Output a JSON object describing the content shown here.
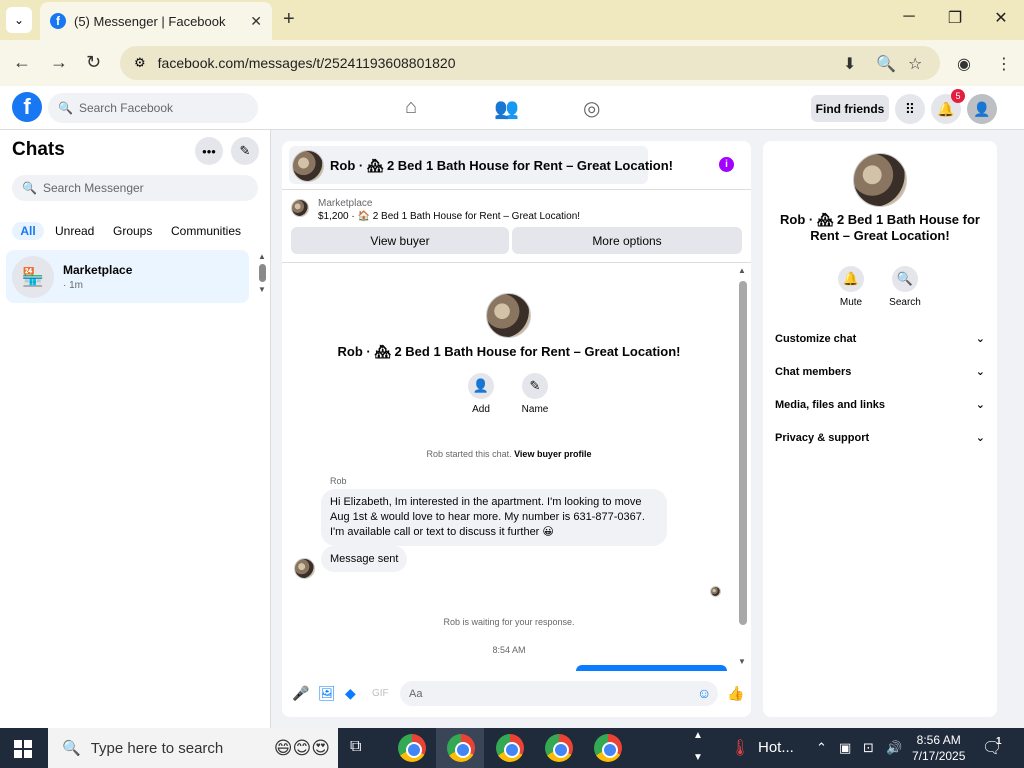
{
  "browser": {
    "tab_title": "(5) Messenger | Facebook",
    "url": "facebook.com/messages/t/25241193608801820"
  },
  "fb_header": {
    "search_placeholder": "Search Facebook",
    "find_friends": "Find friends",
    "notif_count": "5"
  },
  "chats": {
    "title": "Chats",
    "search_placeholder": "Search Messenger",
    "filters": [
      "All",
      "Unread",
      "Groups",
      "Communities"
    ],
    "items": [
      {
        "name": "Marketplace",
        "time": "· 1m"
      }
    ]
  },
  "conversation": {
    "header_title": "Rob · 🏘 2 Bed 1 Bath House for Rent – Great Location!",
    "marketplace_label": "Marketplace",
    "listing_line": "$1,200 · 🏠 2 Bed 1 Bath House for Rent – Great Location!",
    "view_buyer": "View buyer",
    "more_options": "More options",
    "center_title": "Rob · 🏘 2 Bed 1 Bath House for Rent – Great Location!",
    "add_label": "Add",
    "name_label": "Name",
    "started_prefix": "Rob started this chat.",
    "started_link": "View buyer profile",
    "sender": "Rob",
    "message1": "Hi Elizabeth, Im interested in the apartment. I'm looking to move Aug 1st & would love to hear more. My number is 631-877-0367. I'm available call or text to discuss it further 😀",
    "message2": "Message sent",
    "waiting": "Rob is waiting for your response.",
    "time_separator": "8:54 AM",
    "composer_placeholder": "Aa"
  },
  "details": {
    "title": "Rob · 🏘 2 Bed 1 Bath House for Rent – Great Location!",
    "mute": "Mute",
    "search": "Search",
    "sections": [
      "Customize chat",
      "Chat members",
      "Media, files and links",
      "Privacy & support"
    ]
  },
  "taskbar": {
    "search_placeholder": "Type here to search",
    "weather": "Hot...",
    "time": "8:56 AM",
    "date": "7/17/2025",
    "notif_count": "1"
  },
  "colors": {
    "fb_blue": "#1877f2",
    "messenger_blue": "#0a7cff",
    "info_purple": "#a200ff"
  }
}
